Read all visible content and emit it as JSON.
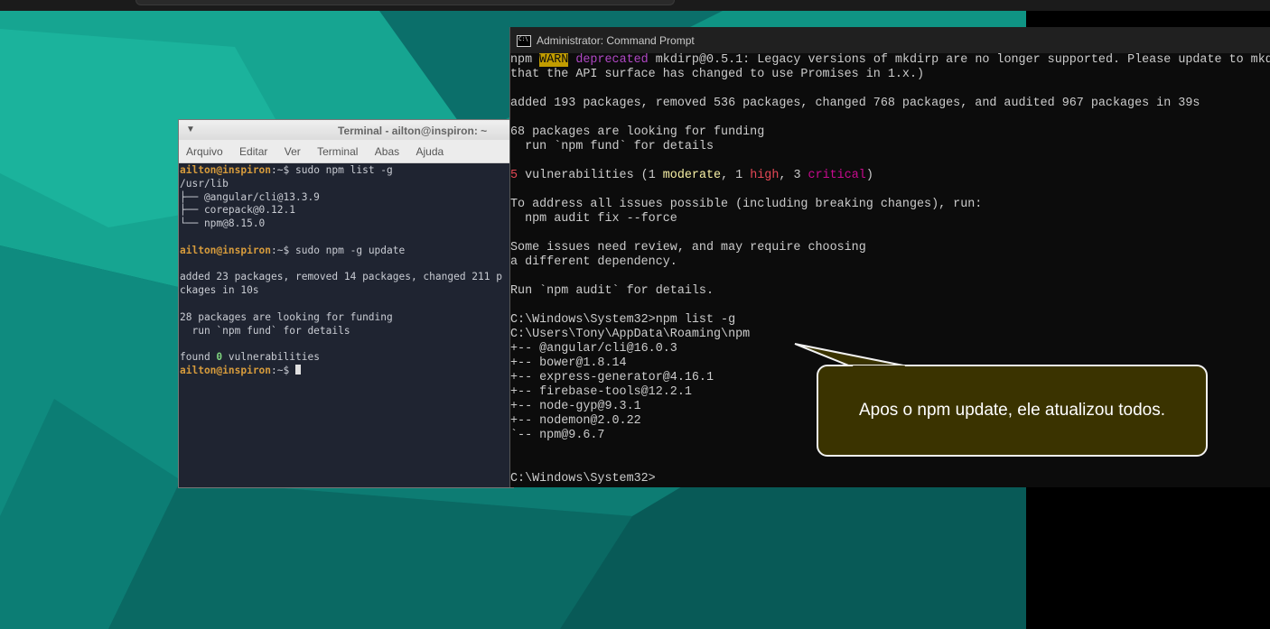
{
  "linux_terminal": {
    "title": "Terminal - ailton@inspiron: ~",
    "menu": [
      "Arquivo",
      "Editar",
      "Ver",
      "Terminal",
      "Abas",
      "Ajuda"
    ],
    "prompt": "ailton@inspiron",
    "prompt_suffix": ":~$ ",
    "cmd1": "sudo npm list -g",
    "out1": "/usr/lib\n├── @angular/cli@13.3.9\n├── corepack@0.12.1\n└── npm@8.15.0",
    "cmd2": "sudo npm -g update",
    "out2": "added 23 packages, removed 14 packages, changed 211 p\nckages in 10s\n\n28 packages are looking for funding\n  run `npm fund` for details\n",
    "found_prefix": "found ",
    "found_zero": "0",
    "found_suffix": " vulnerabilities"
  },
  "cmd_window": {
    "title": "Administrator: Command Prompt",
    "warn_npm": "npm ",
    "warn_tag": "WARN",
    "warn_deprecated": "deprecated",
    "warn_msg": " mkdirp@0.5.1: Legacy versions of mkdirp are no longer supported. Please update to mkdi",
    "warn_msg2": "that the API surface has changed to use Promises in 1.x.)",
    "added": "added 193 packages, removed 536 packages, changed 768 packages, and audited 967 packages in 39s",
    "funding1": "68 packages are looking for funding",
    "funding2": "  run `npm fund` for details",
    "vuln_count": "5",
    "vuln_a": " vulnerabilities (1 ",
    "vuln_moderate": "moderate",
    "vuln_b": ", 1 ",
    "vuln_high": "high",
    "vuln_c": ", 3 ",
    "vuln_critical": "critical",
    "vuln_d": ")",
    "address": "To address all issues possible (including breaking changes), run:\n  npm audit fix --force",
    "review": "Some issues need review, and may require choosing\na different dependency.",
    "run_audit": "Run `npm audit` for details.",
    "list_cmd": "C:\\Windows\\System32>npm list -g",
    "list_out": "C:\\Users\\Tony\\AppData\\Roaming\\npm\n+-- @angular/cli@16.0.3\n+-- bower@1.8.14\n+-- express-generator@4.16.1\n+-- firebase-tools@12.2.1\n+-- node-gyp@9.3.1\n+-- nodemon@2.0.22\n`-- npm@9.6.7",
    "final_prompt": "C:\\Windows\\System32>"
  },
  "callout": {
    "text": "Apos o npm update, ele atualizou todos."
  },
  "colors": {
    "desktop_teal": "#0f8f80",
    "cmd_bg": "#0c0c0c",
    "callout_bg": "#3a3300"
  }
}
